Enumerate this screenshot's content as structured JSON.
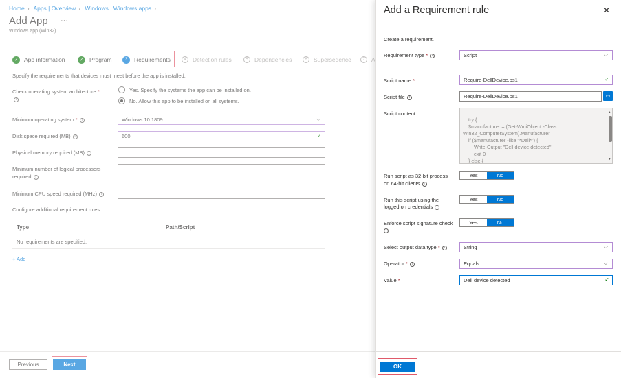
{
  "breadcrumb": {
    "items": [
      "Home",
      "Apps | Overview",
      "Windows | Windows apps"
    ]
  },
  "page": {
    "title": "Add App",
    "subtitle": "Windows app (Win32)"
  },
  "steps": [
    {
      "num": "",
      "label": "App information",
      "state": "done"
    },
    {
      "num": "",
      "label": "Program",
      "state": "done"
    },
    {
      "num": "3",
      "label": "Requirements",
      "state": "current"
    },
    {
      "num": "4",
      "label": "Detection rules",
      "state": "future"
    },
    {
      "num": "5",
      "label": "Dependencies",
      "state": "future"
    },
    {
      "num": "6",
      "label": "Supersedence",
      "state": "future"
    },
    {
      "num": "7",
      "label": "A",
      "state": "future"
    }
  ],
  "requirements": {
    "intro": "Specify the requirements that devices must meet before the app is installed:",
    "arch_label": "Check operating system architecture",
    "arch_option_yes": "Yes. Specify the systems the app can be installed on.",
    "arch_option_no": "No. Allow this app to be installed on all systems.",
    "min_os_label": "Minimum operating system",
    "min_os_value": "Windows 10 1809",
    "disk_label": "Disk space required (MB)",
    "disk_value": "600",
    "memory_label": "Physical memory required (MB)",
    "processors_label_1": "Minimum number of logical processors",
    "processors_label_2": "required",
    "cpu_label": "Minimum CPU speed required (MHz)",
    "additional_label": "Configure additional requirement rules",
    "table": {
      "headers": [
        "Type",
        "Path/Script"
      ],
      "empty": "No requirements are specified."
    },
    "add_link": "+ Add"
  },
  "footer": {
    "previous": "Previous",
    "next": "Next"
  },
  "panel": {
    "title": "Add a Requirement rule",
    "intro": "Create a requirement.",
    "req_type_label": "Requirement type",
    "req_type_value": "Script",
    "script_name_label": "Script name",
    "script_name_value": "Require-DellDevice.ps1",
    "script_file_label": "Script file",
    "script_file_value": "Require-DellDevice.ps1",
    "script_content_label": "Script content",
    "script_content": "try {\n    $manufacturer = (Get-WmiObject -Class\nWin32_ComputerSystem).Manufacturer\n    if ($manufacturer -like \"*Dell*\") {\n        Write-Output \"Dell device detected\"\n        exit 0\n    } else {",
    "run32_label_1": "Run script as 32-bit process",
    "run32_label_2": "on 64-bit clients",
    "logged_label_1": "Run this script using the",
    "logged_label_2": "logged on credentials",
    "enforce_label": "Enforce script signature check",
    "toggle_yes": "Yes",
    "toggle_no": "No",
    "output_type_label": "Select output data type",
    "output_type_value": "String",
    "operator_label": "Operator",
    "operator_value": "Equals",
    "value_label": "Value",
    "value_value": "Dell device detected",
    "ok": "OK"
  },
  "colors": {
    "accent": "#0078d4",
    "success": "#107c10",
    "required": "#a4262c",
    "highlight_box": "#e05a6a"
  }
}
